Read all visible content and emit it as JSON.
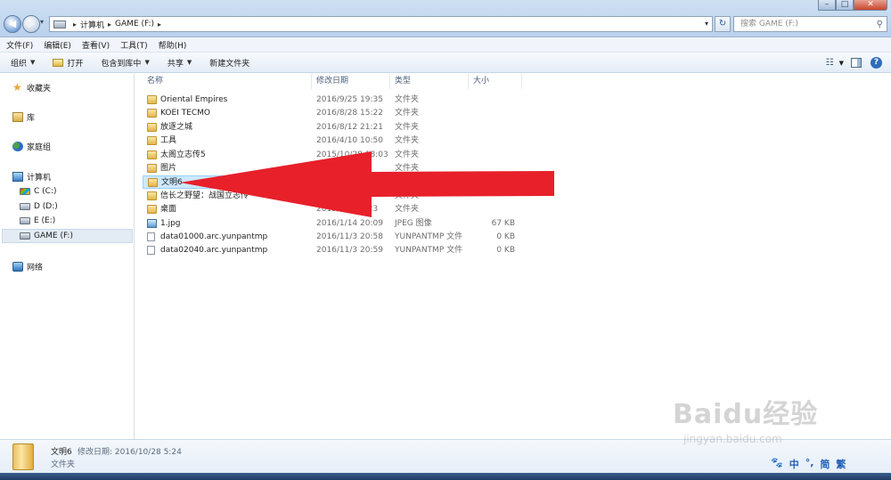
{
  "address": {
    "crumbs": [
      "计算机",
      "GAME (F:)"
    ],
    "search_placeholder": "搜索 GAME (F:)"
  },
  "menu": [
    "文件(F)",
    "编辑(E)",
    "查看(V)",
    "工具(T)",
    "帮助(H)"
  ],
  "commands": {
    "organize": "组织",
    "open": "打开",
    "include_in_library": "包含到库中",
    "share": "共享",
    "new_folder": "新建文件夹"
  },
  "nav": {
    "favorites": "收藏夹",
    "libraries": "库",
    "homegroup": "家庭组",
    "computer": "计算机",
    "drives": [
      "C (C:)",
      "D (D:)",
      "E (E:)",
      "GAME (F:)"
    ],
    "network": "网络"
  },
  "columns": {
    "name": "名称",
    "modified": "修改日期",
    "type": "类型",
    "size": "大小"
  },
  "files": [
    {
      "name": " Oriental Empires",
      "modified": "2016/9/25 19:35",
      "type": "文件夹",
      "size": "",
      "icon": "folder"
    },
    {
      "name": "KOEI TECMO",
      "modified": "2016/8/28 15:22",
      "type": "文件夹",
      "size": "",
      "icon": "folder"
    },
    {
      "name": "放逐之城",
      "modified": "2016/8/12 21:21",
      "type": "文件夹",
      "size": "",
      "icon": "folder"
    },
    {
      "name": "工具",
      "modified": "2016/4/10 10:50",
      "type": "文件夹",
      "size": "",
      "icon": "folder"
    },
    {
      "name": "太阁立志传5",
      "modified": "2015/10/28 18:03",
      "type": "文件夹",
      "size": "",
      "icon": "folder"
    },
    {
      "name": "图片",
      "modified": "",
      "type": "文件夹",
      "size": "",
      "icon": "folder"
    },
    {
      "name": "文明6",
      "modified": "",
      "type": "",
      "size": "",
      "icon": "folder",
      "selected": true
    },
    {
      "name": "信长之野望：战国立志传",
      "modified": "",
      "type": "文件夹",
      "size": "",
      "icon": "folder"
    },
    {
      "name": "桌面",
      "modified": "2015/8/7 20:23",
      "type": "文件夹",
      "size": "",
      "icon": "folder"
    },
    {
      "name": "1.jpg",
      "modified": "2016/1/14 20:09",
      "type": "JPEG 图像",
      "size": "67 KB",
      "icon": "image"
    },
    {
      "name": "data01000.arc.yunpantmp",
      "modified": "2016/11/3 20:58",
      "type": "YUNPANTMP 文件",
      "size": "0 KB",
      "icon": "file"
    },
    {
      "name": "data02040.arc.yunpantmp",
      "modified": "2016/11/3 20:59",
      "type": "YUNPANTMP 文件",
      "size": "0 KB",
      "icon": "file"
    }
  ],
  "details": {
    "name": "文明6",
    "meta": "修改日期: 2016/10/28 5:24",
    "type": "文件夹"
  },
  "watermark": {
    "brand": "Baidu经验",
    "url": "jingyan.baidu.com"
  },
  "ime": [
    "中",
    "°,",
    "简",
    "繁"
  ],
  "colors": {
    "arrow": "#e8202a",
    "selection": "#cde8ff"
  }
}
